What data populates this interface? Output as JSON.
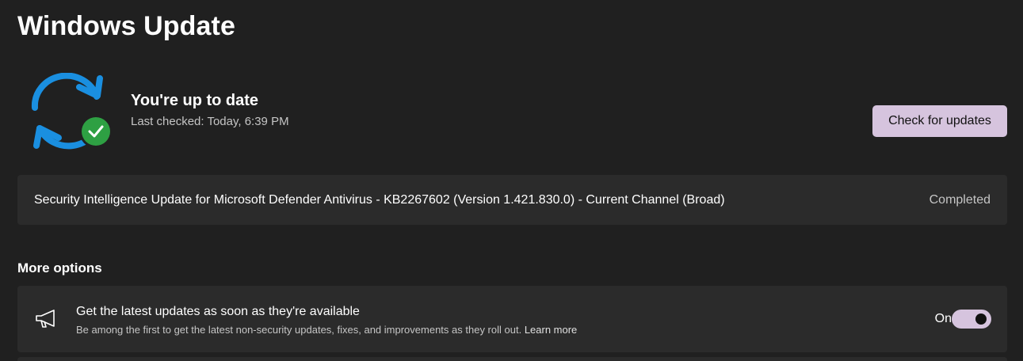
{
  "page": {
    "title": "Windows Update"
  },
  "status": {
    "title": "You're up to date",
    "last_checked": "Last checked: Today, 6:39 PM",
    "check_button_label": "Check for updates",
    "icon": "sync-check-icon"
  },
  "update": {
    "name": "Security Intelligence Update for Microsoft Defender Antivirus - KB2267602 (Version 1.421.830.0) - Current Channel (Broad)",
    "status": "Completed"
  },
  "more_options": {
    "header": "More options",
    "latest_updates": {
      "icon": "megaphone-icon",
      "title": "Get the latest updates as soon as they're available",
      "description": "Be among the first to get the latest non-security updates, fixes, and improvements as they roll out.",
      "link_label": "Learn more",
      "toggle_label": "On",
      "toggle_on": true
    }
  },
  "colors": {
    "background": "#202020",
    "card": "#2b2b2b",
    "accent": "#d6c4de",
    "sync_blue": "#1a8fe0",
    "check_green": "#2ea043"
  }
}
